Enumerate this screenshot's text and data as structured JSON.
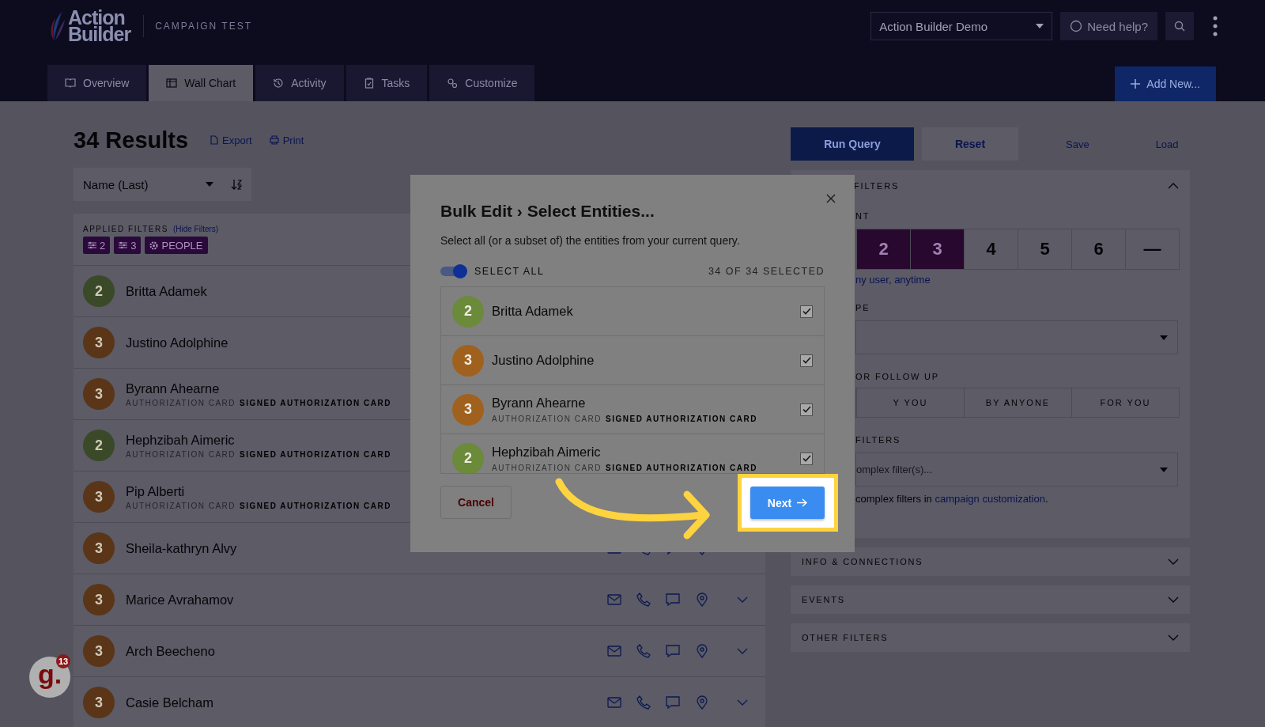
{
  "header": {
    "logo_lines": [
      "Action",
      "Builder"
    ],
    "campaign": "CAMPAIGN TEST",
    "account_select": "Action Builder Demo",
    "help_button": "Need help?",
    "tabs": [
      {
        "label": "Overview",
        "selected": false
      },
      {
        "label": "Wall Chart",
        "selected": true
      },
      {
        "label": "Activity",
        "selected": false
      },
      {
        "label": "Tasks",
        "selected": false
      },
      {
        "label": "Customize",
        "selected": false
      }
    ],
    "add_button": "Add New..."
  },
  "results": {
    "title": "34 Results",
    "export": "Export",
    "print": "Print",
    "sort_select": "Name (Last)",
    "applied_filters": {
      "label": "APPLIED FILTERS",
      "hide_link": "(Hide Filters)",
      "chips": [
        {
          "kind": "level",
          "label": "2"
        },
        {
          "kind": "level",
          "label": "3"
        },
        {
          "kind": "type",
          "label": "PEOPLE"
        }
      ]
    },
    "rows": [
      {
        "name": "Britta Adamek",
        "rating": "2",
        "color": "#3a4a28"
      },
      {
        "name": "Justino Adolphine",
        "rating": "3",
        "color": "#5a3518"
      },
      {
        "name": "Byrann Ahearne",
        "rating": "3",
        "color": "#5a3518",
        "tags": [
          {
            "label": "AUTHORIZATION CARD",
            "highlighted": false
          },
          {
            "label": "SIGNED AUTHORIZATION CARD",
            "highlighted": true
          }
        ]
      },
      {
        "name": "Hephzibah Aimeric",
        "rating": "2",
        "color": "#3a4a28",
        "tags": [
          {
            "label": "AUTHORIZATION CARD",
            "highlighted": false
          },
          {
            "label": "SIGNED AUTHORIZATION CARD",
            "highlighted": true
          }
        ]
      },
      {
        "name": "Pip Alberti",
        "rating": "3",
        "color": "#5a3518",
        "tags": [
          {
            "label": "AUTHORIZATION CARD",
            "highlighted": false
          },
          {
            "label": "SIGNED AUTHORIZATION CARD",
            "highlighted": true
          }
        ]
      },
      {
        "name": "Sheila-kathryn Alvy",
        "rating": "3",
        "color": "#5a3518"
      },
      {
        "name": "Marice Avrahamov",
        "rating": "3",
        "color": "#5a3518"
      },
      {
        "name": "Arch Beecheno",
        "rating": "3",
        "color": "#5a3518"
      },
      {
        "name": "Casie Belcham",
        "rating": "3",
        "color": "#5a3518"
      }
    ]
  },
  "query": {
    "run_button": "Run Query",
    "reset_button": "Reset",
    "save_link": "Save",
    "load_link": "Load",
    "filters_card": {
      "title": "FILTERS",
      "expanded": true,
      "rating_label": "NT",
      "ratings": [
        {
          "label": "2",
          "selected": true
        },
        {
          "label": "3",
          "selected": true
        },
        {
          "label": "4",
          "selected": false
        },
        {
          "label": "5",
          "selected": false
        },
        {
          "label": "6",
          "selected": false
        },
        {
          "label": "—",
          "selected": false
        }
      ],
      "rating_note": "ny user, anytime",
      "type_label": "PE",
      "followup_label": "OR FOLLOW UP",
      "followup_options": [
        {
          "label": "Y YOU",
          "selected": false
        },
        {
          "label": "BY ANYONE",
          "selected": false
        },
        {
          "label": "FOR YOU",
          "selected": false
        }
      ],
      "complex_label": "FILTERS",
      "complex_placeholder": "omplex filter(s)...",
      "complex_note": {
        "before": "complex filters in ",
        "link": "campaign customization",
        "after": "."
      }
    },
    "sections": [
      {
        "title": "INFO & CONNECTIONS",
        "expanded": false
      },
      {
        "title": "EVENTS",
        "expanded": false
      },
      {
        "title": "OTHER FILTERS",
        "expanded": false
      }
    ]
  },
  "modal": {
    "title": "Bulk Edit › Select Entities...",
    "description": "Select all (or a subset of) the entities from your current query.",
    "select_all": {
      "label": "SELECT ALL",
      "on": true
    },
    "count": "34 OF 34 SELECTED",
    "entities": [
      {
        "name": "Britta Adamek",
        "rating": "2",
        "color": "#6b8a3a",
        "checked": true
      },
      {
        "name": "Justino Adolphine",
        "rating": "3",
        "color": "#a0611e",
        "checked": true
      },
      {
        "name": "Byrann Ahearne",
        "rating": "3",
        "color": "#a0611e",
        "tags": [
          {
            "label": "AUTHORIZATION CARD",
            "highlighted": false
          },
          {
            "label": "SIGNED AUTHORIZATION CARD",
            "highlighted": true
          }
        ],
        "checked": true
      },
      {
        "name": "Hephzibah Aimeric",
        "rating": "2",
        "color": "#6b8a3a",
        "tags": [
          {
            "label": "AUTHORIZATION CARD",
            "highlighted": false
          },
          {
            "label": "SIGNED AUTHORIZATION CARD",
            "highlighted": true
          }
        ],
        "checked": true
      }
    ],
    "cancel_button": "Cancel",
    "next_button": "Next"
  },
  "help_widget": {
    "logo": "g.",
    "badge": "13"
  }
}
